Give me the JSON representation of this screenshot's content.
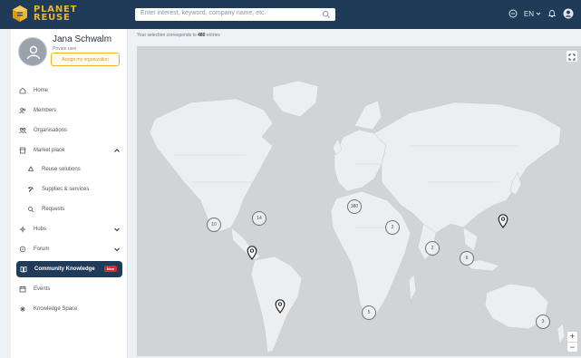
{
  "brand": {
    "line1": "PLANET",
    "line2": "REUSE",
    "accent": "#f0b429",
    "header_bg": "#1f3b57"
  },
  "search": {
    "placeholder": "Enter interest, keyword, company name, etc."
  },
  "header": {
    "language": "EN"
  },
  "profile": {
    "name": "Jana Schwalm",
    "role": "Private user",
    "org_button": "Assign my organization"
  },
  "nav": {
    "home": "Home",
    "members": "Members",
    "organisations": "Organisations",
    "marketplace": "Market place",
    "reuse_solutions": "Reuse solutions",
    "supplies_services": "Supplies & services",
    "requests": "Requests",
    "hubs": "Hubs",
    "forum": "Forum",
    "community_knowledge": "Community Knowledge",
    "community_knowledge_badge": "New",
    "events": "Events",
    "knowledge_space": "Knowledge Space"
  },
  "map": {
    "caption_prefix": "Your selection corresponds to",
    "entries_count": "480",
    "caption_suffix": "entries",
    "clusters": [
      {
        "label": "10"
      },
      {
        "label": "14"
      },
      {
        "label": "380"
      },
      {
        "label": "2"
      },
      {
        "label": "2"
      },
      {
        "label": "6"
      },
      {
        "label": "5"
      },
      {
        "label": "3"
      }
    ],
    "zoom_in": "+",
    "zoom_out": "−"
  }
}
